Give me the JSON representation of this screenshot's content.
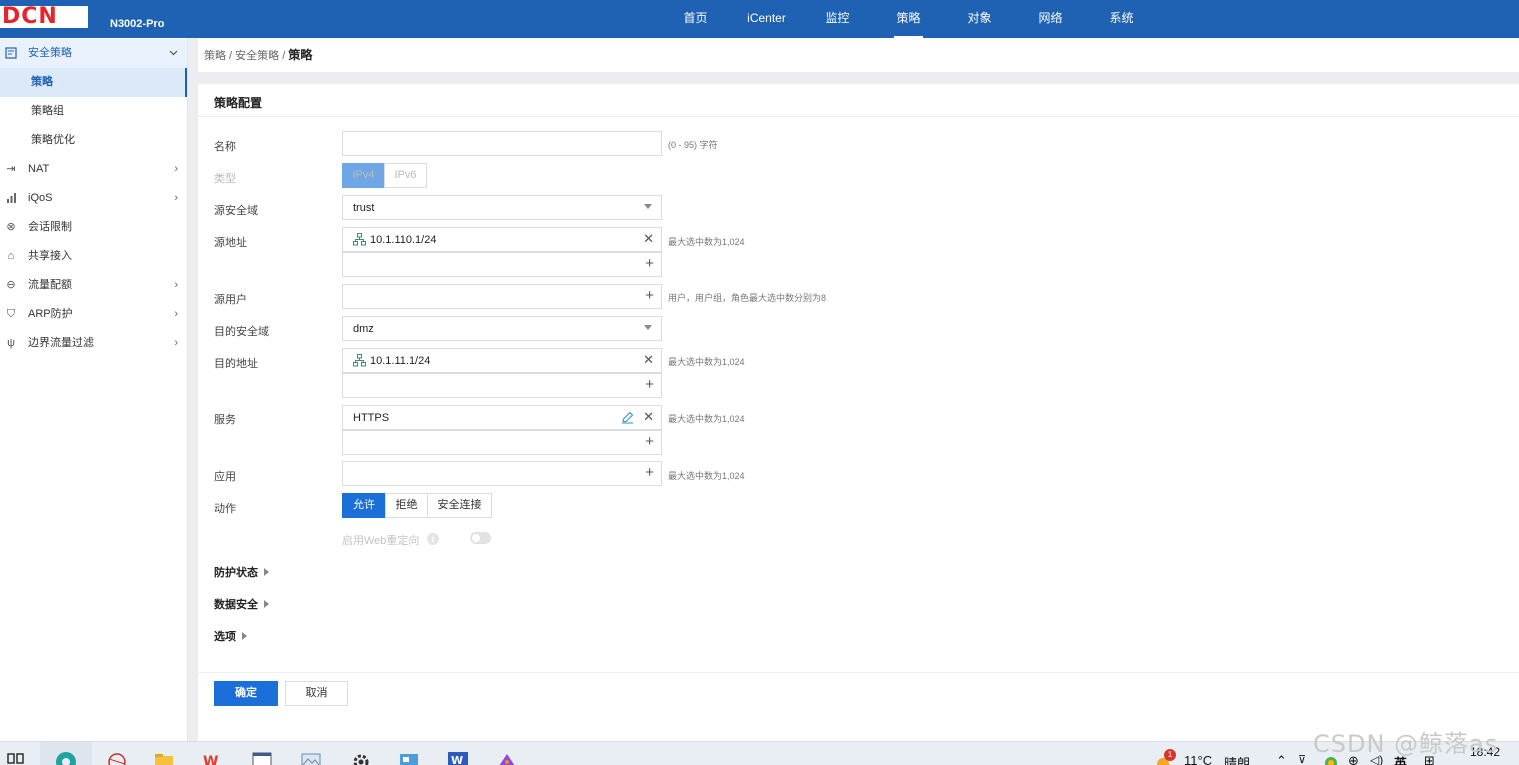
{
  "header": {
    "logo": "DCN",
    "model": "N3002-Pro",
    "nav": [
      {
        "label": "首页",
        "active": false
      },
      {
        "label": "iCenter",
        "active": false
      },
      {
        "label": "监控",
        "active": false
      },
      {
        "label": "策略",
        "active": true
      },
      {
        "label": "对象",
        "active": false
      },
      {
        "label": "网络",
        "active": false
      },
      {
        "label": "系统",
        "active": false
      }
    ]
  },
  "sidebar": {
    "group": {
      "label": "安全策略",
      "icon": "policy-icon",
      "expanded": true
    },
    "sub_items": [
      {
        "label": "策略",
        "active": true
      },
      {
        "label": "策略组",
        "active": false
      },
      {
        "label": "策略优化",
        "active": false
      }
    ],
    "items": [
      {
        "label": "NAT",
        "icon": "nat-icon",
        "has_children": true
      },
      {
        "label": "iQoS",
        "icon": "bar-chart-icon",
        "has_children": true
      },
      {
        "label": "会话限制",
        "icon": "session-limit-icon",
        "has_children": false
      },
      {
        "label": "共享接入",
        "icon": "share-icon",
        "has_children": false
      },
      {
        "label": "流量配额",
        "icon": "quota-icon",
        "has_children": true
      },
      {
        "label": "ARP防护",
        "icon": "shield-icon",
        "has_children": true
      },
      {
        "label": "边界流量过滤",
        "icon": "filter-icon",
        "has_children": true
      }
    ]
  },
  "breadcrumb": {
    "path": "策略 / 安全策略 / ",
    "current": "策略"
  },
  "form": {
    "title": "策略配置",
    "name": {
      "label": "名称",
      "value": "",
      "hint": "(0 - 95) 字符"
    },
    "type": {
      "label": "类型",
      "options": [
        "IPv4",
        "IPv6"
      ],
      "selected": "IPv4"
    },
    "src_zone": {
      "label": "源安全域",
      "value": "trust"
    },
    "src_addr": {
      "label": "源地址",
      "value": "10.1.110.1/24",
      "hint": "最大选中数为1,024"
    },
    "src_user": {
      "label": "源用户",
      "value": "",
      "hint": "用户，用户组，角色最大选中数分别为8"
    },
    "dst_zone": {
      "label": "目的安全域",
      "value": "dmz"
    },
    "dst_addr": {
      "label": "目的地址",
      "value": "10.1.11.1/24",
      "hint": "最大选中数为1,024"
    },
    "service": {
      "label": "服务",
      "value": "HTTPS",
      "hint": "最大选中数为1,024"
    },
    "app": {
      "label": "应用",
      "value": "",
      "hint": "最大选中数为1,024"
    },
    "action": {
      "label": "动作",
      "options": [
        "允许",
        "拒绝",
        "安全连接"
      ],
      "selected": "允许"
    },
    "web_redirect": {
      "label": "启用Web重定向",
      "enabled": false
    },
    "sections": [
      "防护状态",
      "数据安全",
      "选项"
    ],
    "ok_label": "确定",
    "cancel_label": "取消"
  },
  "taskbar": {
    "weather_temp": "11°C",
    "weather_desc": "晴朗",
    "notification_count": "1",
    "ime": "英",
    "time": "18:42"
  },
  "watermark": "CSDN @鲸落as",
  "colors": {
    "header_bg": "#1f62b3",
    "primary": "#1a6fd8",
    "logo_red": "#e8242a"
  }
}
